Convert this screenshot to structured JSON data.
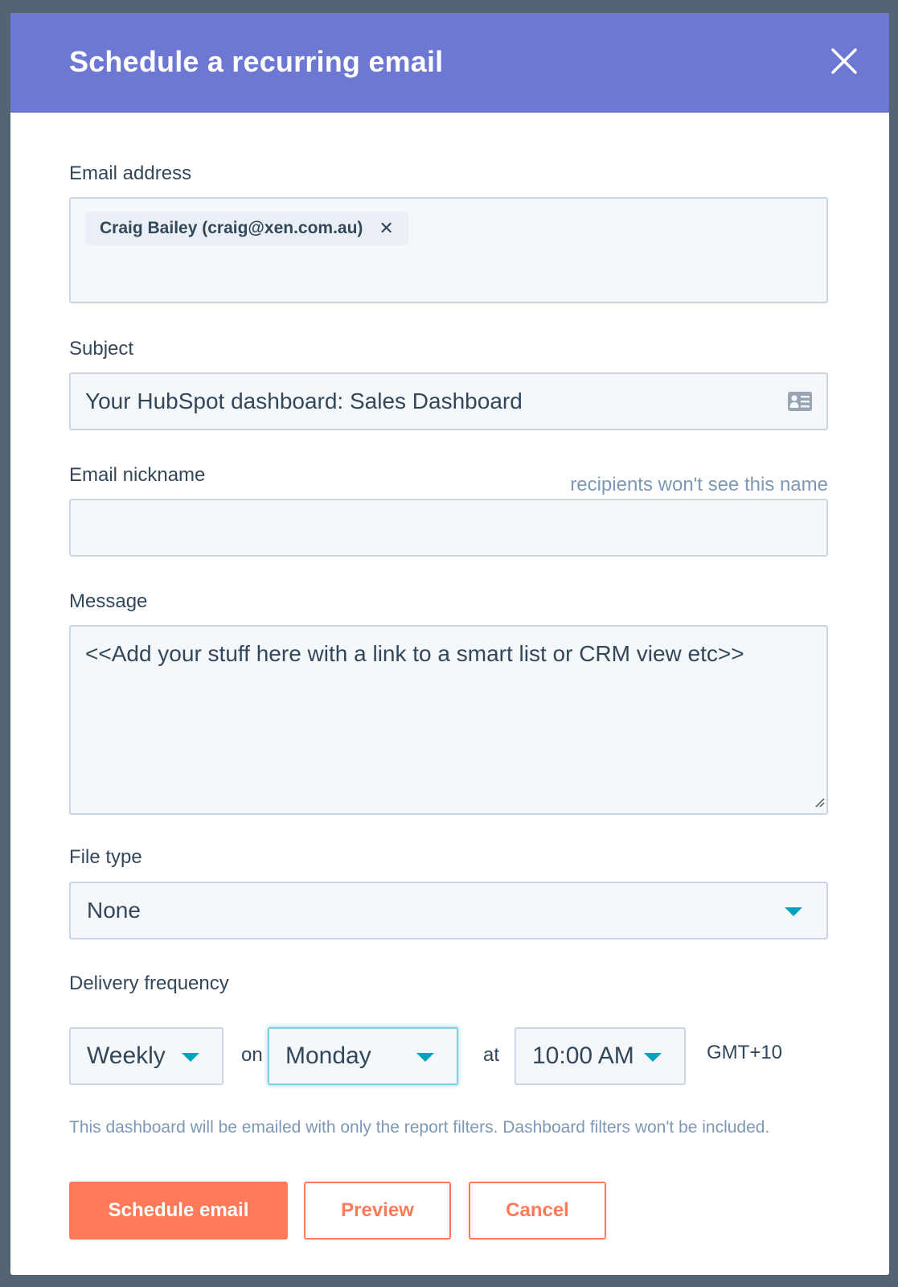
{
  "modal": {
    "title": "Schedule a recurring email",
    "close_icon": "close-icon"
  },
  "email_address": {
    "label": "Email address",
    "recipients": [
      {
        "label": "Craig Bailey (craig@xen.com.au)",
        "remove_glyph": "✕"
      }
    ]
  },
  "subject": {
    "label": "Subject",
    "value": "Your HubSpot dashboard: Sales Dashboard",
    "icon": "contact-card-icon"
  },
  "nickname": {
    "label": "Email nickname",
    "hint": "recipients won't see this name",
    "value": ""
  },
  "message": {
    "label": "Message",
    "value": "<<Add your stuff here with a link to a smart list or CRM view etc>>"
  },
  "file_type": {
    "label": "File type",
    "selected": "None"
  },
  "delivery": {
    "label": "Delivery frequency",
    "frequency": "Weekly",
    "on_label": "on",
    "day": "Monday",
    "at_label": "at",
    "time": "10:00 AM",
    "timezone": "GMT+10",
    "note": "This dashboard will be emailed with only the report filters. Dashboard filters won't be included."
  },
  "buttons": {
    "schedule": "Schedule email",
    "preview": "Preview",
    "cancel": "Cancel"
  },
  "colors": {
    "header": "#6c78d1",
    "accent": "#ff7a59",
    "caret": "#00a4bd",
    "hint": "#7c98b6"
  }
}
